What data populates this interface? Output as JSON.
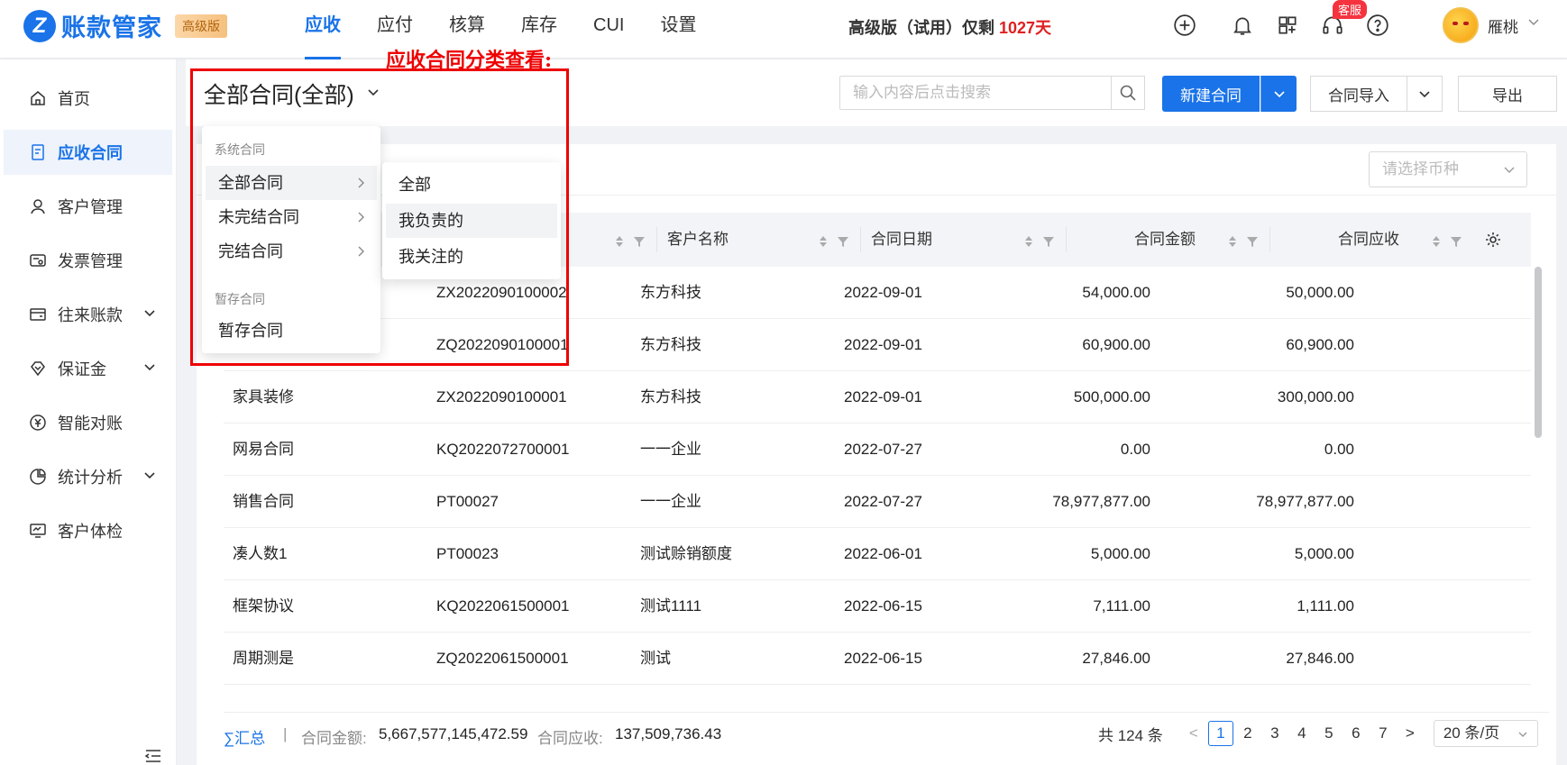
{
  "header": {
    "logo_letter": "Z",
    "logo_text": "账款管家",
    "edition_badge": "高级版",
    "nav": [
      "应收",
      "应付",
      "核算",
      "库存",
      "CUI",
      "设置"
    ],
    "trial_prefix": "高级版（试用）仅剩 ",
    "trial_days": "1027天",
    "kefu_badge": "客服",
    "username": "雁桃"
  },
  "sidebar": {
    "items": [
      "首页",
      "应收合同",
      "客户管理",
      "发票管理",
      "往来账款",
      "保证金",
      "智能对账",
      "统计分析",
      "客户体检"
    ]
  },
  "toolbar": {
    "title": "全部合同(全部)",
    "search_placeholder": "输入内容后点击搜索",
    "new_label": "新建合同",
    "import_label": "合同导入",
    "export_label": "导出",
    "currency_placeholder": "请选择币种"
  },
  "table": {
    "headers": [
      "客户名称",
      "合同日期",
      "合同金额",
      "合同应收"
    ],
    "rows": [
      {
        "name": "",
        "code": "ZX2022090100002",
        "customer": "东方科技",
        "date": "2022-09-01",
        "amount": "54,000.00",
        "receivable": "50,000.00"
      },
      {
        "name": "",
        "code": "ZQ2022090100001",
        "customer": "东方科技",
        "date": "2022-09-01",
        "amount": "60,900.00",
        "receivable": "60,900.00"
      },
      {
        "name": "家具装修",
        "code": "ZX2022090100001",
        "customer": "东方科技",
        "date": "2022-09-01",
        "amount": "500,000.00",
        "receivable": "300,000.00"
      },
      {
        "name": "网易合同",
        "code": "KQ2022072700001",
        "customer": "一一企业",
        "date": "2022-07-27",
        "amount": "0.00",
        "receivable": "0.00"
      },
      {
        "name": "销售合同",
        "code": "PT00027",
        "customer": "一一企业",
        "date": "2022-07-27",
        "amount": "78,977,877.00",
        "receivable": "78,977,877.00"
      },
      {
        "name": "凑人数1",
        "code": "PT00023",
        "customer": "测试赊销额度",
        "date": "2022-06-01",
        "amount": "5,000.00",
        "receivable": "5,000.00"
      },
      {
        "name": "框架协议",
        "code": "KQ2022061500001",
        "customer": "测试1111",
        "date": "2022-06-15",
        "amount": "7,111.00",
        "receivable": "1,111.00"
      },
      {
        "name": "周期测是",
        "code": "ZQ2022061500001",
        "customer": "测试",
        "date": "2022-06-15",
        "amount": "27,846.00",
        "receivable": "27,846.00"
      }
    ]
  },
  "footer": {
    "sum_title": "∑汇总",
    "sep": "|",
    "amount_label": "合同金额:",
    "amount_value": "5,667,577,145,472.59",
    "receivable_label": "合同应收:",
    "receivable_value": "137,509,736.43",
    "total": "共 124 条",
    "pages": [
      "1",
      "2",
      "3",
      "4",
      "5",
      "6",
      "7"
    ],
    "page_size": "20 条/页",
    "prev": "<",
    "next": ">"
  },
  "dropdown": {
    "group1": "系统合同",
    "items1": [
      "全部合同",
      "未完结合同",
      "完结合同"
    ],
    "group2": "暂存合同",
    "items2": [
      "暂存合同"
    ],
    "submenu": [
      "全部",
      "我负责的",
      "我关注的"
    ]
  },
  "annotation": "应收合同分类查看:",
  "colors": {
    "accent": "#1a73e8",
    "annotation": "#e00000",
    "trial_days": "#e02020"
  }
}
